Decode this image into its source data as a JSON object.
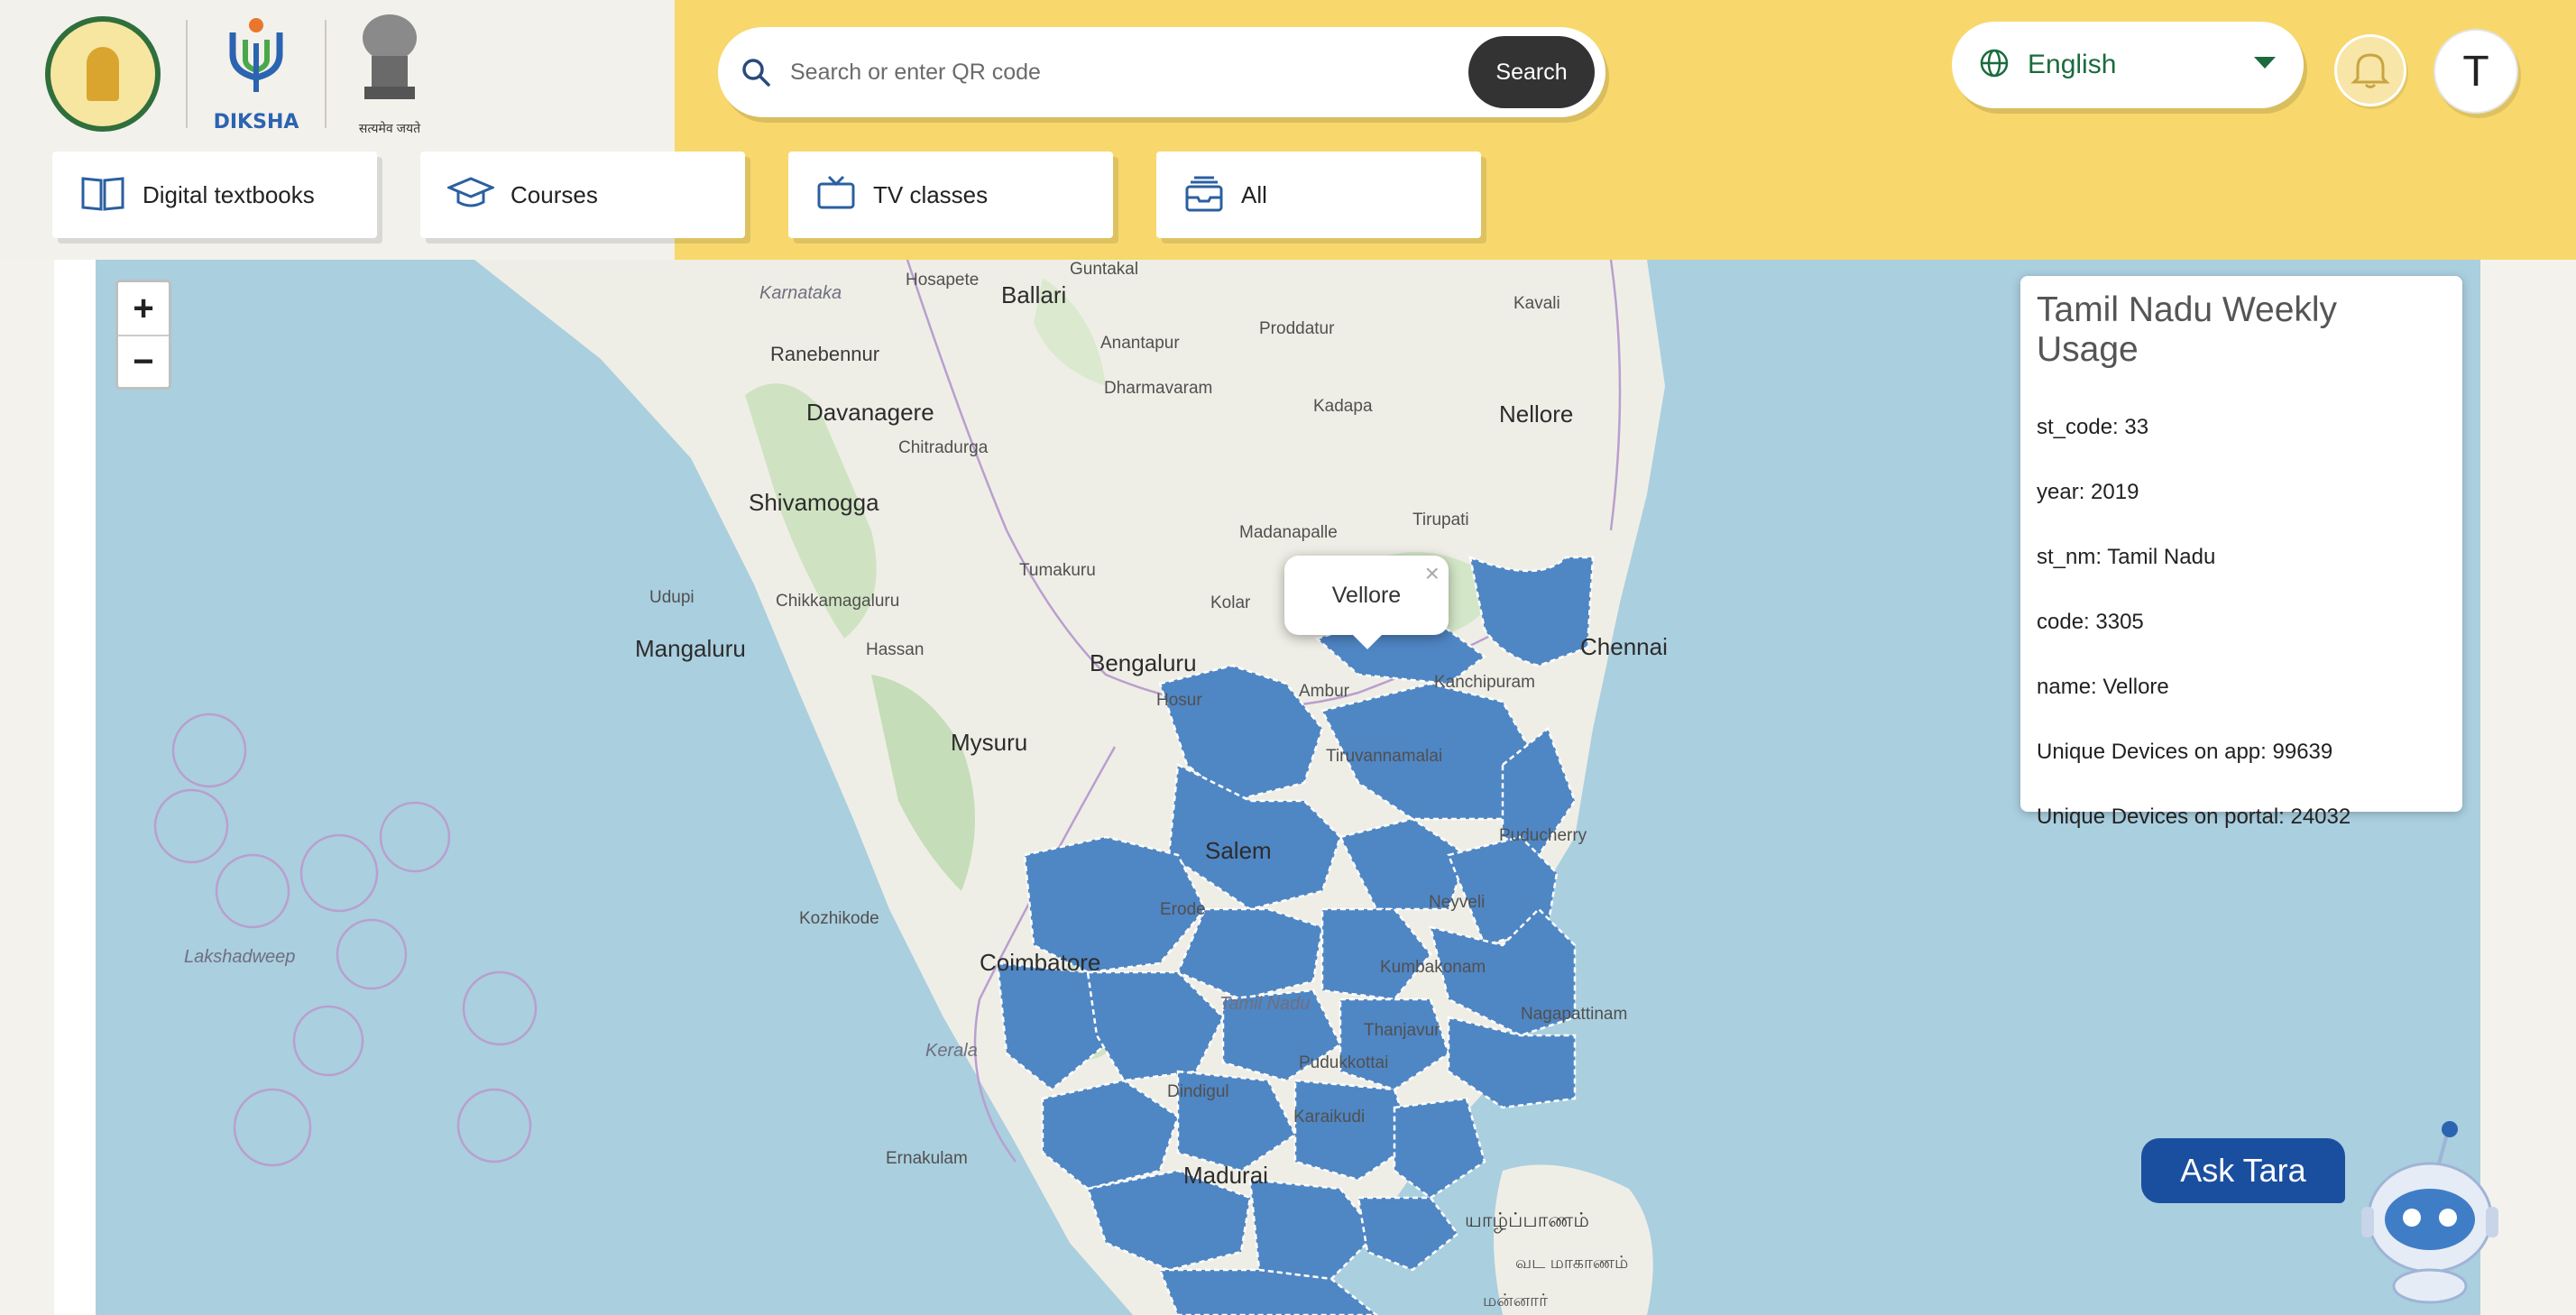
{
  "header": {
    "diksha_label": "DIKSHA",
    "emblem_label": "सत्यमेव जयते",
    "search_placeholder": "Search or enter QR code",
    "search_button": "Search",
    "language": "English",
    "avatar_initial": "T"
  },
  "categories": [
    {
      "label": "Digital textbooks",
      "icon": "book-icon"
    },
    {
      "label": "Courses",
      "icon": "graduation-cap-icon"
    },
    {
      "label": "TV classes",
      "icon": "tv-icon"
    },
    {
      "label": "All",
      "icon": "inbox-icon"
    }
  ],
  "map": {
    "zoom_in": "+",
    "zoom_out": "−",
    "places": {
      "hosapete": "Hosapete",
      "guntakal": "Guntakal",
      "karnataka": "Karnataka",
      "ballari": "Ballari",
      "kavali": "Kavali",
      "ranebennur": "Ranebennur",
      "anantapur": "Anantapur",
      "proddatur": "Proddatur",
      "dharmavaram": "Dharmavaram",
      "davanagere": "Davanagere",
      "kadapa": "Kadapa",
      "nellore": "Nellore",
      "chitradurga": "Chitradurga",
      "shivamogga": "Shivamogga",
      "tirupati": "Tirupati",
      "madanapalle": "Madanapalle",
      "tumakuru": "Tumakuru",
      "udupi": "Udupi",
      "chikkamagaluru": "Chikkamagaluru",
      "kolar": "Kolar",
      "mangaluru": "Mangaluru",
      "hassan": "Hassan",
      "bengaluru": "Bengaluru",
      "chennai": "Chennai",
      "kanchipuram": "Kanchipuram",
      "ambur": "Ambur",
      "hosur": "Hosur",
      "mysuru": "Mysuru",
      "tiruvannamalai": "Tiruvannamalai",
      "salem": "Salem",
      "puducherry": "Puducherry",
      "erode": "Erode",
      "kozhikode": "Kozhikode",
      "neyveli": "Neyveli",
      "lakshadweep": "Lakshadweep",
      "coimbatore": "Coimbatore",
      "kumbakonam": "Kumbakonam",
      "tamil_nadu": "Tamil Nadu",
      "thanjavur": "Thanjavur",
      "kerala": "Kerala",
      "nagapattinam": "Nagapattinam",
      "pudukkottai": "Pudukkottai",
      "dindigul": "Dindigul",
      "karaikudi": "Karaikudi",
      "ernakulam": "Ernakulam",
      "madurai": "Madurai",
      "jaffna": "யாழ்ப்பாணம்",
      "vadamaradchi": "வட மாகாணம்",
      "mannar": "மன்னார்"
    },
    "popup": {
      "text": "Vellore",
      "close": "×"
    }
  },
  "info_panel": {
    "title": "Tamil Nadu Weekly Usage",
    "rows": [
      "st_code: 33",
      "year: 2019",
      "st_nm: Tamil Nadu",
      "code: 3305",
      "name: Vellore",
      "Unique Devices on app: 99639",
      "Unique Devices on portal: 24032"
    ]
  },
  "assistant": {
    "label": "Ask Tara"
  },
  "colors": {
    "header_yellow": "#f8d86c",
    "district_fill": "#4f86c4",
    "sea": "#aacfdf",
    "land": "#efeee6",
    "primary_blue": "#1a4fa0"
  }
}
